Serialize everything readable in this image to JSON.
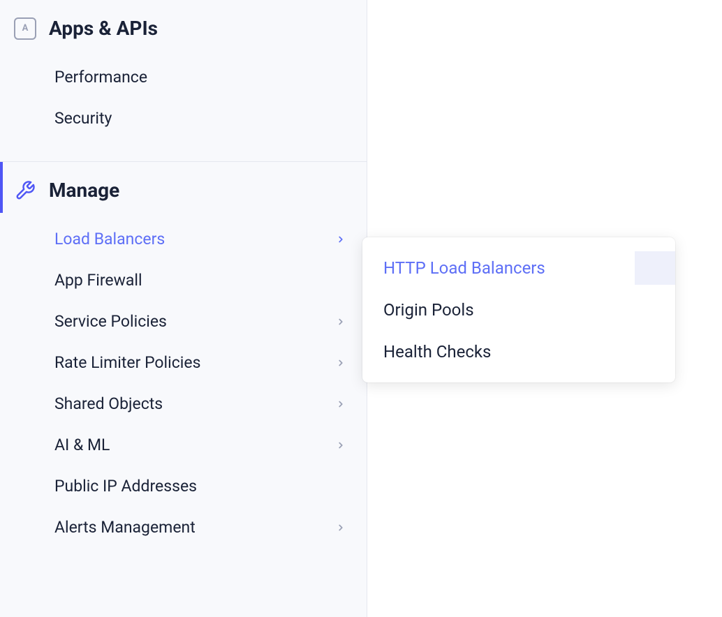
{
  "sidebar": {
    "sections": [
      {
        "title": "Apps & APIs",
        "icon": "apps-icon",
        "items": [
          {
            "label": "Performance",
            "has_chevron": false
          },
          {
            "label": "Security",
            "has_chevron": false
          }
        ]
      },
      {
        "title": "Manage",
        "icon": "wrench-icon",
        "active": true,
        "items": [
          {
            "label": "Load Balancers",
            "has_chevron": true,
            "selected": true
          },
          {
            "label": "App Firewall",
            "has_chevron": false
          },
          {
            "label": "Service Policies",
            "has_chevron": true
          },
          {
            "label": "Rate Limiter Policies",
            "has_chevron": true
          },
          {
            "label": "Shared Objects",
            "has_chevron": true
          },
          {
            "label": "AI & ML",
            "has_chevron": true
          },
          {
            "label": "Public IP Addresses",
            "has_chevron": false
          },
          {
            "label": "Alerts Management",
            "has_chevron": true
          }
        ]
      }
    ]
  },
  "submenu": {
    "items": [
      {
        "label": "HTTP Load Balancers",
        "selected": true,
        "highlighted": true
      },
      {
        "label": "Origin Pools"
      },
      {
        "label": "Health Checks"
      }
    ]
  },
  "apps_icon_letter": "A"
}
